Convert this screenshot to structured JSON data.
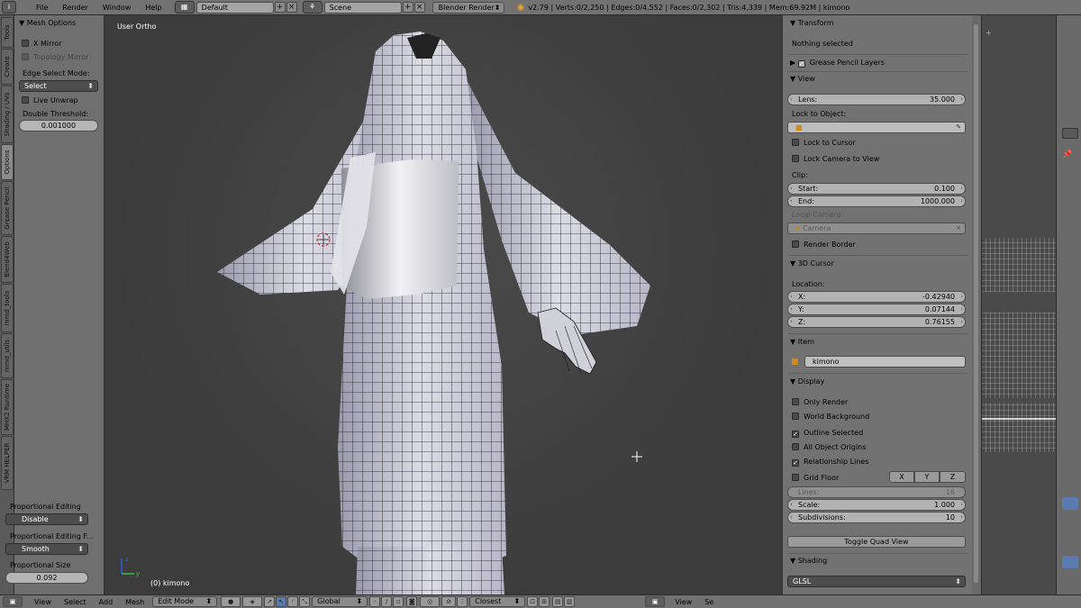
{
  "topbar": {
    "menus": [
      "File",
      "Render",
      "Window",
      "Help"
    ],
    "screen_layout": "Default",
    "scene": "Scene",
    "render_engine": "Blender Render",
    "stats": "v2.79 | Verts:0/2,250 | Edges:0/4,552 | Faces:0/2,302 | Tris:4,339 | Mem:69.92M | kimono"
  },
  "tool_tabs": [
    "Tools",
    "Create",
    "Shading / UVs",
    "Options",
    "Grease Pencil",
    "Blend4Web",
    "mmd_tools",
    "mmd_utils",
    "MHX2 Runtime",
    "VRM HELPER"
  ],
  "left_panel": {
    "mesh_options_header": "Mesh Options",
    "x_mirror": "X Mirror",
    "topology_mirror": "Topology Mirror",
    "edge_select_mode_label": "Edge Select Mode:",
    "edge_select_mode_value": "Select",
    "live_unwrap": "Live Unwrap",
    "double_threshold_label": "Double Threshold:",
    "double_threshold_value": "0.001000",
    "prop_editing_label": "Proportional Editing",
    "prop_editing_value": "Disable",
    "prop_falloff_label": "Proportional Editing F...",
    "prop_falloff_value": "Smooth",
    "prop_size_label": "Proportional Size",
    "prop_size_value": "0.092"
  },
  "viewport": {
    "view_label": "User Ortho",
    "object_label": "(0) kimono"
  },
  "properties": {
    "transform_header": "Transform",
    "nothing_selected": "Nothing selected",
    "grease_pencil_layers": "Grease Pencil Layers",
    "view_header": "View",
    "lens_label": "Lens:",
    "lens_value": "35.000",
    "lock_to_object_label": "Lock to Object:",
    "lock_to_cursor": "Lock to Cursor",
    "lock_camera_to_view": "Lock Camera to View",
    "clip_label": "Clip:",
    "clip_start_label": "Start:",
    "clip_start_value": "0.100",
    "clip_end_label": "End:",
    "clip_end_value": "1000.000",
    "local_camera_label": "Local Camera:",
    "local_camera_value": "Camera",
    "render_border": "Render Border",
    "cursor_header": "3D Cursor",
    "location_label": "Location:",
    "loc_x_label": "X:",
    "loc_x_value": "-0.42940",
    "loc_y_label": "Y:",
    "loc_y_value": "0.07144",
    "loc_z_label": "Z:",
    "loc_z_value": "0.76155",
    "item_header": "Item",
    "item_name": "kimono",
    "display_header": "Display",
    "only_render": "Only Render",
    "world_background": "World Background",
    "outline_selected": "Outline Selected",
    "all_object_origins": "All Object Origins",
    "relationship_lines": "Relationship Lines",
    "grid_floor": "Grid Floor",
    "axis_x": "X",
    "axis_y": "Y",
    "axis_z": "Z",
    "lines_label": "Lines:",
    "lines_value": "16",
    "scale_label": "Scale:",
    "scale_value": "1.000",
    "subdivisions_label": "Subdivisions:",
    "subdivisions_value": "10",
    "toggle_quad_view": "Toggle Quad View",
    "shading_header": "Shading",
    "shading_value": "GLSL"
  },
  "bottombar": {
    "menus": [
      "View",
      "Select",
      "Add",
      "Mesh"
    ],
    "mode": "Edit Mode",
    "pivot": "Global",
    "snap": "Closest",
    "uv_menus": [
      "View",
      "Se"
    ]
  },
  "colors": {
    "panel_bg": "#727272",
    "viewport_bg": "#3d3d3d",
    "mesh_fill": "#d8d8e0",
    "checkbox_bg": "#4a4a4a"
  }
}
